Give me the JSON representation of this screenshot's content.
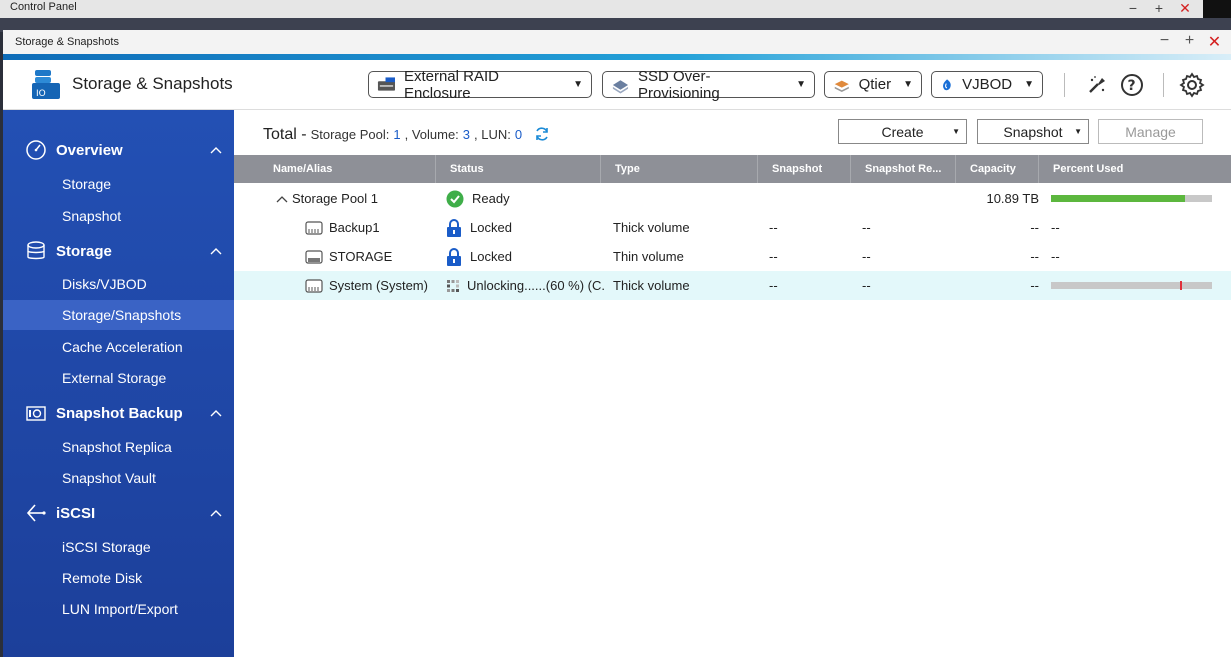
{
  "control_panel": {
    "title": "Control Panel"
  },
  "window": {
    "title": "Storage & Snapshots"
  },
  "header": {
    "app_title": "Storage & Snapshots",
    "buttons": {
      "external_raid": "External RAID Enclosure",
      "ssd_overprovisioning": "SSD Over-Provisioning",
      "qtier": "Qtier",
      "vjbod": "VJBOD"
    }
  },
  "sidebar": {
    "groups": {
      "overview": "Overview",
      "storage": "Storage",
      "snapshot_backup": "Snapshot Backup",
      "iscsi": "iSCSI"
    },
    "items": {
      "storage": "Storage",
      "snapshot": "Snapshot",
      "disks": "Disks/VJBOD",
      "storage_snapshots": "Storage/Snapshots",
      "cache": "Cache Acceleration",
      "external_storage": "External Storage",
      "snapshot_replica": "Snapshot Replica",
      "snapshot_vault": "Snapshot Vault",
      "iscsi_storage": "iSCSI Storage",
      "remote_disk": "Remote Disk",
      "lun_import_export": "LUN Import/Export"
    }
  },
  "summary": {
    "label": "Total -",
    "pool_label": "Storage Pool:",
    "pool_count": "1",
    "volume_label": ", Volume:",
    "volume_count": "3",
    "lun_label": ", LUN:",
    "lun_count": "0"
  },
  "actions": {
    "create": "Create",
    "snapshot": "Snapshot",
    "manage": "Manage"
  },
  "table": {
    "columns": {
      "name": "Name/Alias",
      "status": "Status",
      "type": "Type",
      "snapshot": "Snapshot",
      "snapshot_re": "Snapshot Re...",
      "capacity": "Capacity",
      "percent_used": "Percent Used"
    },
    "rows": [
      {
        "name": "Storage Pool 1",
        "status": "Ready",
        "type": "",
        "snapshot": "",
        "snapshot_re": "",
        "capacity": "10.89 TB",
        "percent_used": 0.83,
        "percent_text": ""
      },
      {
        "name": "Backup1",
        "status": "Locked",
        "type": "Thick volume",
        "snapshot": "--",
        "snapshot_re": "--",
        "capacity": "--",
        "percent_used": null,
        "percent_text": "--"
      },
      {
        "name": "STORAGE",
        "status": "Locked",
        "type": "Thin volume",
        "snapshot": "--",
        "snapshot_re": "--",
        "capacity": "--",
        "percent_used": null,
        "percent_text": "--"
      },
      {
        "name": "System (System)",
        "status": "Unlocking......(60 %) (C...",
        "type": "Thick volume",
        "snapshot": "--",
        "snapshot_re": "--",
        "capacity": "--",
        "percent_used": 0.8,
        "percent_text": ""
      }
    ]
  },
  "colors": {
    "sidebar": "#2350b4",
    "accent": "#1a5cc8",
    "ready": "#3fae49",
    "bar_fill": "#5cb73e"
  }
}
